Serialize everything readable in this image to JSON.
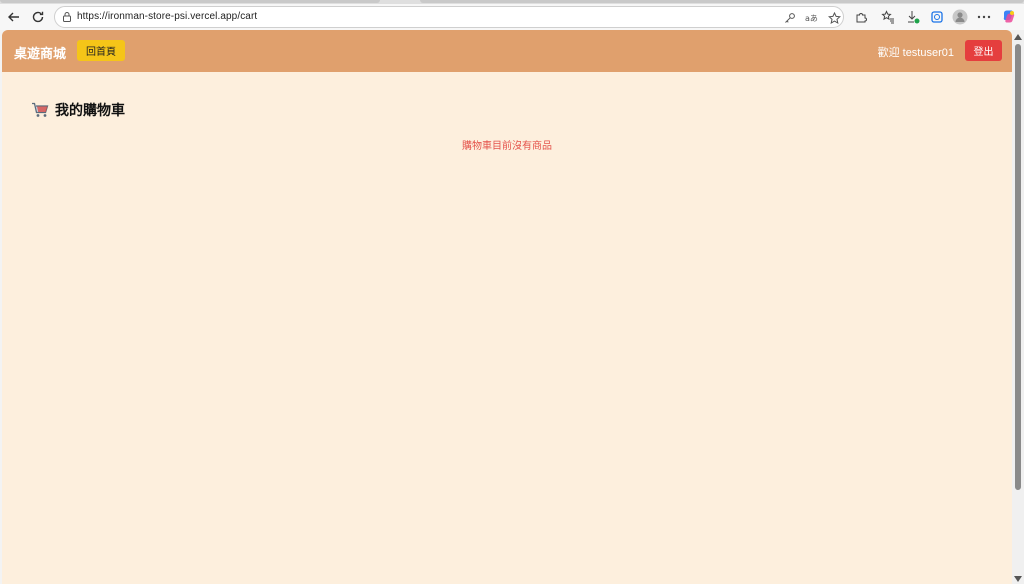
{
  "browser": {
    "url": "https://ironman-store-psi.vercel.app/cart"
  },
  "navbar": {
    "brand": "桌遊商城",
    "home_label": "回首頁",
    "welcome": "歡迎 testuser01",
    "logout_label": "登出"
  },
  "main": {
    "title": "我的購物車",
    "empty_message": "購物車目前沒有商品"
  }
}
